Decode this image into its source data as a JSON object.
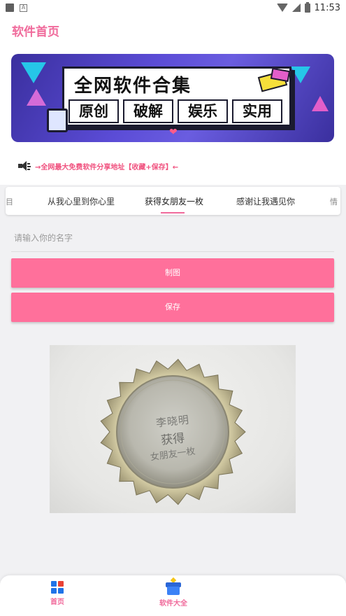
{
  "status_bar": {
    "time": "11:53",
    "a_icon": "A"
  },
  "header": {
    "title": "软件首页"
  },
  "banner": {
    "heading": "全网软件合集",
    "tags": [
      "原创",
      "破解",
      "娱乐",
      "实用"
    ]
  },
  "notice": {
    "text": "→全网最大免费软件分享地址【收藏+保存】←"
  },
  "tabs": {
    "items": [
      "从我心里到你心里",
      "获得女朋友一枚",
      "感谢让我遇见你"
    ],
    "selected": "获得女朋友一枚",
    "edge_left": "目",
    "edge_right": "情"
  },
  "name_input": {
    "placeholder": "请输入你的名字",
    "value": ""
  },
  "buttons": {
    "draw": "制图",
    "save": "保存"
  },
  "result_image": {
    "line1": "李晓明",
    "line2": "获得",
    "line3": "女朋友一枚"
  },
  "bottom_nav": {
    "items": [
      {
        "label": "首页",
        "icon": "home-grid-icon"
      },
      {
        "label": "软件大全",
        "icon": "gift-box-icon"
      }
    ]
  },
  "colors": {
    "accent": "#f06a9b",
    "button": "#ff709b"
  }
}
